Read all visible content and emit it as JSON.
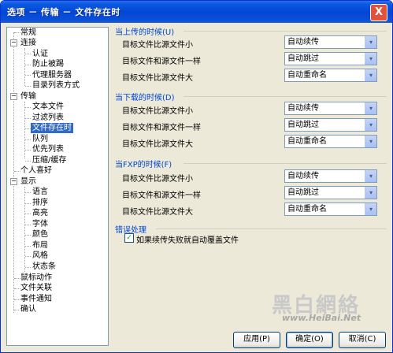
{
  "window": {
    "title": "选项 － 传输 － 文件存在时",
    "close_label": "X"
  },
  "tree": {
    "items": [
      {
        "label": "常规"
      },
      {
        "label": "连接"
      },
      {
        "label": "认证"
      },
      {
        "label": "防止被踢"
      },
      {
        "label": "代理服务器"
      },
      {
        "label": "目录列表方式"
      },
      {
        "label": "传输"
      },
      {
        "label": "文本文件"
      },
      {
        "label": "过滤列表"
      },
      {
        "label": "文件存在时"
      },
      {
        "label": "队列"
      },
      {
        "label": "优先列表"
      },
      {
        "label": "压缩/缓存"
      },
      {
        "label": "个人喜好"
      },
      {
        "label": "显示"
      },
      {
        "label": "语言"
      },
      {
        "label": "排序"
      },
      {
        "label": "高亮"
      },
      {
        "label": "字体"
      },
      {
        "label": "颜色"
      },
      {
        "label": "布局"
      },
      {
        "label": "风格"
      },
      {
        "label": "状态条"
      },
      {
        "label": "鼠标动作"
      },
      {
        "label": "文件关联"
      },
      {
        "label": "事件通知"
      },
      {
        "label": "确认"
      }
    ],
    "expanders": [
      "−",
      "−",
      "−"
    ]
  },
  "sections": {
    "upload": {
      "title": "当上传的时候(U)",
      "rows": [
        {
          "label": "目标文件比源文件小",
          "value": "自动续传"
        },
        {
          "label": "目标文件和源文件一样",
          "value": "自动跳过"
        },
        {
          "label": "目标文件比源文件大",
          "value": "自动重命名"
        }
      ]
    },
    "download": {
      "title": "当下载的时候(D)",
      "rows": [
        {
          "label": "目标文件比源文件小",
          "value": "自动续传"
        },
        {
          "label": "目标文件和源文件一样",
          "value": "自动跳过"
        },
        {
          "label": "目标文件比源文件大",
          "value": "自动重命名"
        }
      ]
    },
    "fxp": {
      "title": "当FXP的时候(F)",
      "rows": [
        {
          "label": "目标文件比源文件小",
          "value": "自动续传"
        },
        {
          "label": "目标文件和源文件一样",
          "value": "自动跳过"
        },
        {
          "label": "目标文件比源文件大",
          "value": "自动重命名"
        }
      ]
    },
    "error": {
      "title": "错误处理",
      "checkbox_label": "如果续传失败就自动覆盖文件",
      "checkbox_checked": true,
      "check_mark": "✓"
    }
  },
  "dropdown_arrow": "▾",
  "watermark": {
    "chinese": "黑白網絡",
    "url": "www.HeiBai.Net"
  },
  "buttons": {
    "apply": "应用(P)",
    "ok": "确定(O)",
    "cancel": "取消(C)"
  }
}
